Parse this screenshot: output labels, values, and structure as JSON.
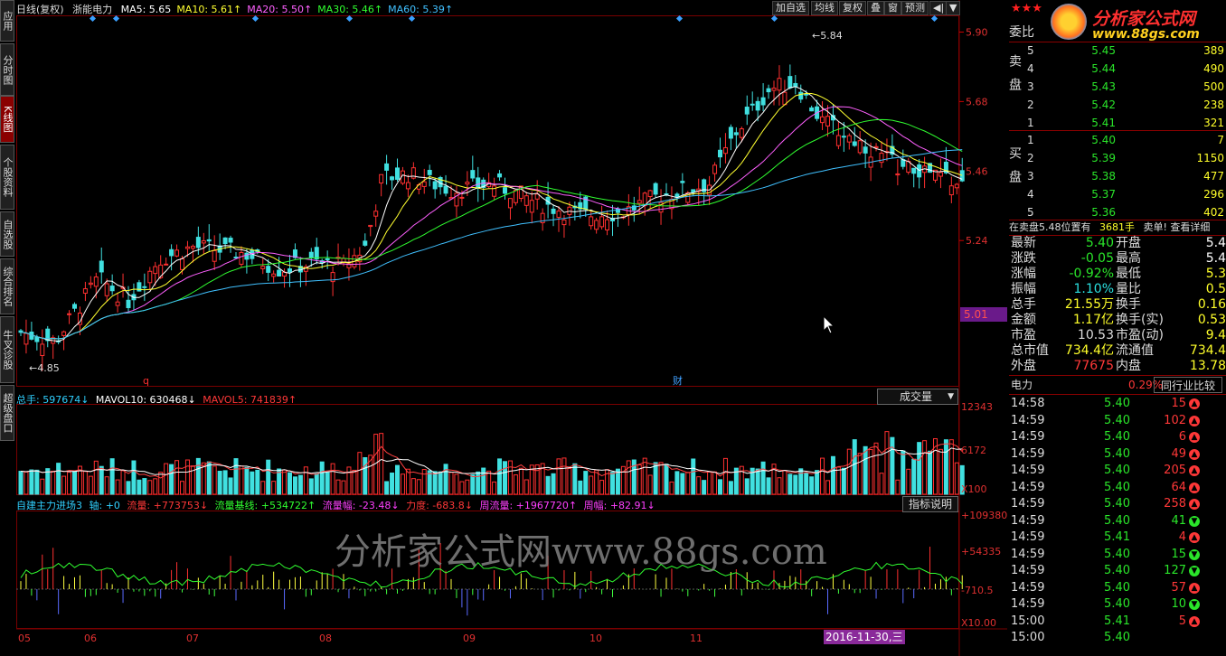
{
  "title": {
    "period": "日线(复权)",
    "stock": "浙能电力"
  },
  "ma": [
    {
      "label": "MA5: 5.65",
      "color": "#ffffff"
    },
    {
      "label": "MA10: 5.61↑",
      "color": "#ffff30"
    },
    {
      "label": "MA20: 5.50↑",
      "color": "#ff60ff"
    },
    {
      "label": "MA30: 5.46↑",
      "color": "#30ff30"
    },
    {
      "label": "MA60: 5.39↑",
      "color": "#40c0ff"
    }
  ],
  "toolbar": {
    "add_fav": "加自选",
    "ma_line": "均线",
    "restore": "复权",
    "overlay": "叠",
    "window": "窗",
    "forecast": "预测",
    "nav": "◀|",
    "menu": "▼"
  },
  "left_tabs": [
    {
      "label": "应用"
    },
    {
      "label": "分时图"
    },
    {
      "label": "K线图"
    },
    {
      "label": "个股资料"
    },
    {
      "label": "自选股"
    },
    {
      "label": "综合排名"
    },
    {
      "label": "牛叉诊股"
    },
    {
      "label": "超级盘口"
    }
  ],
  "price_axis": [
    "5.90",
    "5.68",
    "5.46",
    "5.24",
    "5.01"
  ],
  "price_highlight": "5.01",
  "high_label": "5.84",
  "low_label": "4.85",
  "markers": {
    "q": "q",
    "cai": "财"
  },
  "volume": {
    "total": "总手: 597674↓",
    "mavol10": "MAVOL10: 630468↓",
    "mavol5": "MAVOL5: 741839↑",
    "dropdown": "成交量",
    "axis": [
      "12343",
      "6172",
      "X100"
    ]
  },
  "indicator": {
    "name": "自建主力进场3",
    "axis_label": "轴: +0",
    "flow": "流量: +773753↓",
    "base": "流量基线: +534722↑",
    "amp": "流量幅: -23.48↓",
    "force": "力度: -683.8↓",
    "week_flow": "周流量: +1967720↑",
    "week_amp": "周幅: +82.91↓",
    "explain": "指标说明",
    "axis": [
      "+109380",
      "+54335",
      "-710.5",
      "X10.00"
    ]
  },
  "watermark": "分析家公式网www.88gs.com",
  "x_axis": [
    "05",
    "06",
    "07",
    "08",
    "09",
    "10",
    "11"
  ],
  "cursor_date": "2016-11-30,三",
  "logo": {
    "name": "分析家公式网",
    "url": "www.88gs.com"
  },
  "order_book": {
    "ratio_label": "委比",
    "sell_label": "卖盘",
    "buy_label": "买盘",
    "sells": [
      {
        "lvl": "5",
        "price": "5.45",
        "vol": "389"
      },
      {
        "lvl": "4",
        "price": "5.44",
        "vol": "490"
      },
      {
        "lvl": "3",
        "price": "5.43",
        "vol": "500"
      },
      {
        "lvl": "2",
        "price": "5.42",
        "vol": "238"
      },
      {
        "lvl": "1",
        "price": "5.41",
        "vol": "321"
      }
    ],
    "buys": [
      {
        "lvl": "1",
        "price": "5.40",
        "vol": "7"
      },
      {
        "lvl": "2",
        "price": "5.39",
        "vol": "1150"
      },
      {
        "lvl": "3",
        "price": "5.38",
        "vol": "477"
      },
      {
        "lvl": "4",
        "price": "5.37",
        "vol": "296"
      },
      {
        "lvl": "5",
        "price": "5.36",
        "vol": "402"
      }
    ],
    "notice": "在卖盘5.48位置有",
    "notice_vol": "3681手",
    "notice_tail": "卖单! 查看详细"
  },
  "quote": [
    {
      "k1": "最新",
      "v1": "5.40",
      "k2": "开盘",
      "v2": "5.4"
    },
    {
      "k1": "涨跌",
      "v1": "-0.05",
      "k2": "最高",
      "v2": "5.4"
    },
    {
      "k1": "涨幅",
      "v1": "-0.92%",
      "k2": "最低",
      "v2": "5.3"
    },
    {
      "k1": "振幅",
      "v1": "1.10%",
      "k2": "量比",
      "v2": "0.5"
    },
    {
      "k1": "总手",
      "v1": "21.55万",
      "k2": "换手",
      "v2": "0.16"
    },
    {
      "k1": "金额",
      "v1": "1.17亿",
      "k2": "换手(实)",
      "v2": "0.53"
    },
    {
      "k1": "市盈",
      "v1": "10.53",
      "k2": "市盈(动)",
      "v2": "9.4"
    },
    {
      "k1": "总市值",
      "v1": "734.4亿",
      "k2": "流通值",
      "v2": "734.4"
    },
    {
      "k1": "外盘",
      "v1": "77675",
      "k2": "内盘",
      "v2": "13.78"
    }
  ],
  "industry": {
    "name": "电力",
    "pct": "0.29%",
    "compare": "同行业比较"
  },
  "ticks": [
    {
      "t": "14:58",
      "p": "5.40",
      "v": "15",
      "d": "up"
    },
    {
      "t": "14:59",
      "p": "5.40",
      "v": "102",
      "d": "up"
    },
    {
      "t": "14:59",
      "p": "5.40",
      "v": "6",
      "d": "up"
    },
    {
      "t": "14:59",
      "p": "5.40",
      "v": "49",
      "d": "up"
    },
    {
      "t": "14:59",
      "p": "5.40",
      "v": "205",
      "d": "up"
    },
    {
      "t": "14:59",
      "p": "5.40",
      "v": "64",
      "d": "up"
    },
    {
      "t": "14:59",
      "p": "5.40",
      "v": "258",
      "d": "up"
    },
    {
      "t": "14:59",
      "p": "5.40",
      "v": "41",
      "d": "down"
    },
    {
      "t": "14:59",
      "p": "5.41",
      "v": "4",
      "d": "up"
    },
    {
      "t": "14:59",
      "p": "5.40",
      "v": "15",
      "d": "down"
    },
    {
      "t": "14:59",
      "p": "5.40",
      "v": "127",
      "d": "down"
    },
    {
      "t": "14:59",
      "p": "5.40",
      "v": "57",
      "d": "up"
    },
    {
      "t": "14:59",
      "p": "5.40",
      "v": "10",
      "d": "down"
    },
    {
      "t": "15:00",
      "p": "5.41",
      "v": "5",
      "d": "up"
    },
    {
      "t": "15:00",
      "p": "5.40",
      "v": "",
      "d": ""
    }
  ]
}
